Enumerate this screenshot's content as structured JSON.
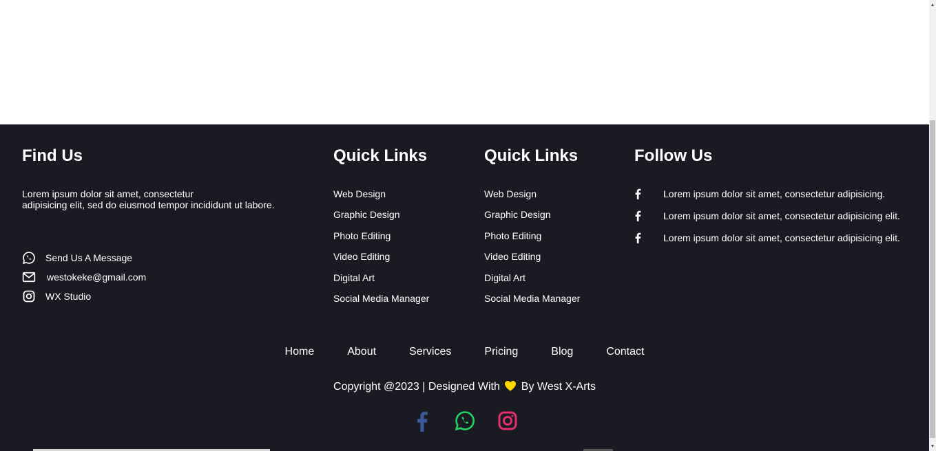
{
  "find_us": {
    "title": "Find Us",
    "desc_line1": "Lorem ipsum dolor sit amet, consectetur",
    "desc_line2": "adipisicing elit, sed do eiusmod tempor incididunt ut labore.",
    "contacts": [
      {
        "icon": "whatsapp-icon",
        "text": "Send Us A Message"
      },
      {
        "icon": "envelope-icon",
        "text": "westokeke@gmail.com"
      },
      {
        "icon": "instagram-icon",
        "text": "WX Studio"
      }
    ]
  },
  "quick_links_1": {
    "title": "Quick Links",
    "items": [
      "Web Design",
      "Graphic Design",
      "Photo Editing",
      "Video Editing",
      "Digital Art",
      "Social Media Manager"
    ]
  },
  "quick_links_2": {
    "title": "Quick Links",
    "items": [
      "Web Design",
      "Graphic Design",
      "Photo Editing",
      "Video Editing",
      "Digital Art",
      "Social Media Manager"
    ]
  },
  "follow_us": {
    "title": "Follow Us",
    "items": [
      {
        "icon": "facebook-icon",
        "text": "Lorem ipsum dolor sit amet, consectetur adipisicing."
      },
      {
        "icon": "facebook-icon",
        "text": "Lorem ipsum dolor sit amet, consectetur adipisicing elit."
      },
      {
        "icon": "facebook-icon",
        "text": "Lorem ipsum dolor sit amet, consectetur adipisicing elit."
      }
    ]
  },
  "nav": [
    "Home",
    "About",
    "Services",
    "Pricing",
    "Blog",
    "Contact"
  ],
  "copyright": {
    "before": "Copyright @2023 | Designed With",
    "after": "By West X-Arts",
    "heart_icon": "heart-icon"
  },
  "socials": [
    {
      "icon": "facebook-icon",
      "color": "#3b5998"
    },
    {
      "icon": "whatsapp-icon",
      "color": "#25d366"
    },
    {
      "icon": "instagram-icon",
      "color": "#e1306c"
    }
  ],
  "colors": {
    "footer_bg": "#1a1a22",
    "text": "#ffffff",
    "heart": "#ffd700"
  }
}
